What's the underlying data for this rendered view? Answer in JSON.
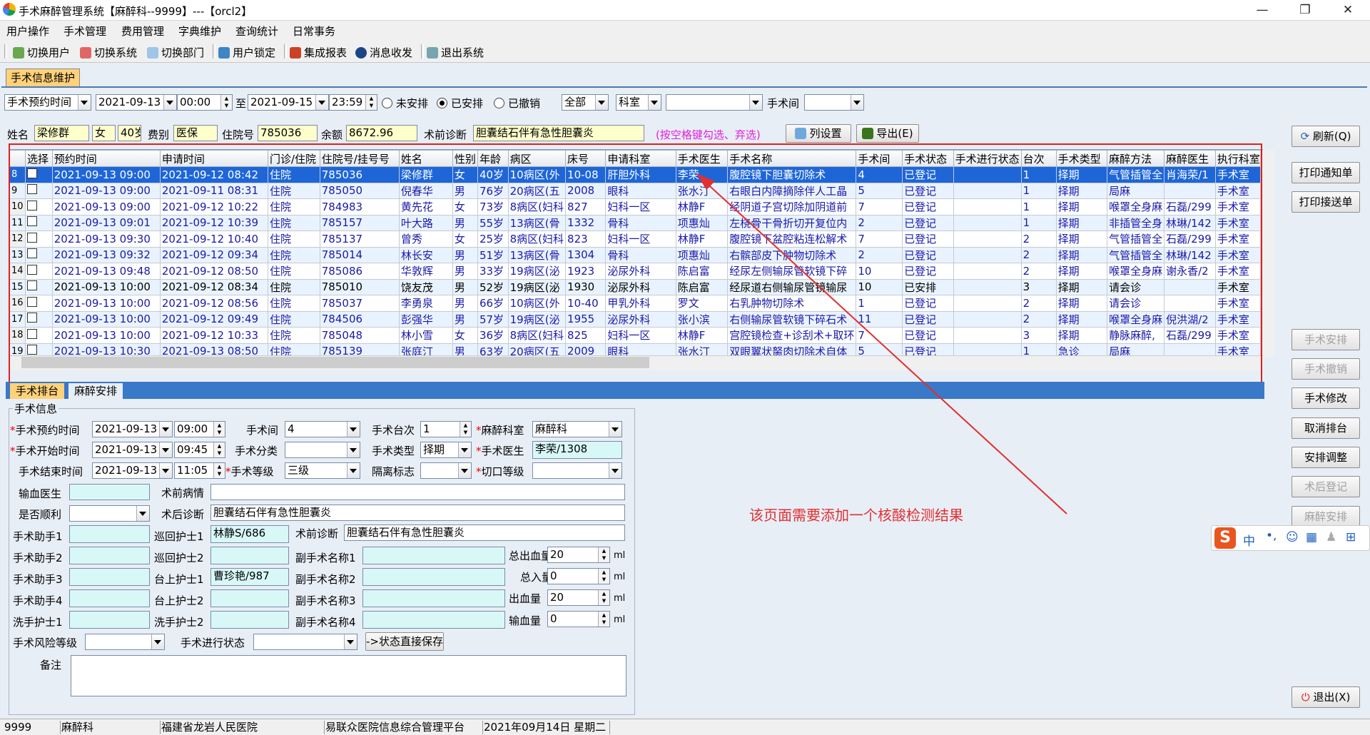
{
  "window": {
    "title": "手术麻醉管理系统【麻醉科--9999】---【orcl2】",
    "minimize": "—",
    "maximize": "❐",
    "close": "✕"
  },
  "menu": [
    "用户操作",
    "手术管理",
    "费用管理",
    "字典维护",
    "查询统计",
    "日常事务"
  ],
  "toolbar": [
    "切换用户",
    "切换系统",
    "切换部门",
    "用户锁定",
    "集成报表",
    "消息收发",
    "退出系统"
  ],
  "top_tab": "手术信息维护",
  "filter": {
    "time_type": "手术预约时间",
    "date_from": "2021-09-13",
    "time_from": "00:00",
    "to": "至",
    "date_to": "2021-09-15",
    "time_to": "23:59",
    "radio_unarranged": "未安排",
    "radio_arranged": "已安排",
    "radio_cancelled": "已撤销",
    "scope": "全部",
    "dept": "科室",
    "dept_value": "",
    "room_label": "手术间",
    "room_value": ""
  },
  "patient_bar": {
    "name_label": "姓名",
    "name": "梁修群",
    "sex": "女",
    "age": "40岁",
    "fee_label": "费别",
    "fee": "医保",
    "inpatient_label": "住院号",
    "inpatient_no": "785036",
    "balance_label": "余额",
    "balance": "8672.96",
    "diag_label": "术前诊断",
    "diagnosis": "胆囊结石伴有急性胆囊炎",
    "hint": "(按空格键勾选、弃选)",
    "col_setting": "列设置",
    "export": "导出(E)"
  },
  "grid": {
    "headers": [
      "",
      "选择",
      "预约时间",
      "申请时间",
      "门诊/住院",
      "住院号/挂号号",
      "姓名",
      "性别",
      "年龄",
      "病区",
      "床号",
      "申请科室",
      "手术医生",
      "手术名称",
      "手术间",
      "手术状态",
      "手术进行状态",
      "台次",
      "手术类型",
      "麻醉方法",
      "麻醉医生",
      "执行科室"
    ],
    "rows": [
      [
        "8",
        "",
        "2021-09-13 09:00",
        "2021-09-12 08:42",
        "住院",
        "785036",
        "梁修群",
        "女",
        "40岁",
        "10病区(外",
        "10-08",
        "肝胆外科",
        "李荣",
        "腹腔镜下胆囊切除术",
        "4",
        "已登记",
        "",
        "1",
        "择期",
        "气管插管全",
        "肖海荣/1",
        "手术室"
      ],
      [
        "9",
        "",
        "2021-09-13 09:00",
        "2021-09-11 08:31",
        "住院",
        "785050",
        "倪春华",
        "男",
        "76岁",
        "20病区(五",
        "2008",
        "眼科",
        "张水汀",
        "右眼白内障摘除伴人工晶",
        "5",
        "已登记",
        "",
        "1",
        "择期",
        "局麻",
        "",
        "手术室"
      ],
      [
        "10",
        "",
        "2021-09-13 09:00",
        "2021-09-12 10:22",
        "住院",
        "784983",
        "黄先花",
        "女",
        "73岁",
        "8病区(妇科",
        "827",
        "妇科一区",
        "林静F",
        "经阴道子宫切除加阴道前",
        "7",
        "已登记",
        "",
        "1",
        "择期",
        "喉罩全身麻",
        "石磊/299",
        "手术室"
      ],
      [
        "11",
        "",
        "2021-09-13 09:01",
        "2021-09-12 10:39",
        "住院",
        "785157",
        "叶大路",
        "男",
        "55岁",
        "13病区(骨",
        "1332",
        "骨科",
        "项惠灿",
        "左桡骨干骨折切开复位内",
        "2",
        "已登记",
        "",
        "1",
        "择期",
        "非插管全身",
        "林琳/142",
        "手术室"
      ],
      [
        "12",
        "",
        "2021-09-13 09:30",
        "2021-09-12 10:40",
        "住院",
        "785137",
        "曾秀",
        "女",
        "25岁",
        "8病区(妇科",
        "823",
        "妇科一区",
        "林静F",
        "腹腔镜下盆腔粘连松解术",
        "7",
        "已登记",
        "",
        "2",
        "择期",
        "气管插管全",
        "石磊/299",
        "手术室"
      ],
      [
        "13",
        "",
        "2021-09-13 09:32",
        "2021-09-12 09:34",
        "住院",
        "785014",
        "林长安",
        "男",
        "51岁",
        "13病区(骨",
        "1304",
        "骨科",
        "项惠灿",
        "右髌部皮下肿物切除术",
        "2",
        "已登记",
        "",
        "2",
        "择期",
        "气管插管全",
        "林琳/142",
        "手术室"
      ],
      [
        "14",
        "",
        "2021-09-13 09:48",
        "2021-09-12 08:50",
        "住院",
        "785086",
        "华敦辉",
        "男",
        "33岁",
        "19病区(泌",
        "1923",
        "泌尿外科",
        "陈启富",
        "经尿左侧输尿管软镜下碎",
        "10",
        "已登记",
        "",
        "2",
        "择期",
        "喉罩全身麻",
        "谢永香/2",
        "手术室"
      ],
      [
        "15",
        "",
        "2021-09-13 10:00",
        "2021-09-12 08:34",
        "住院",
        "785010",
        "饶友茂",
        "男",
        "52岁",
        "19病区(泌",
        "1930",
        "泌尿外科",
        "陈启富",
        "经尿道右侧输尿管镜输尿",
        "10",
        "已安排",
        "",
        "3",
        "择期",
        "请会诊",
        "",
        "手术室"
      ],
      [
        "16",
        "",
        "2021-09-13 10:00",
        "2021-09-12 08:56",
        "住院",
        "785037",
        "李勇泉",
        "男",
        "66岁",
        "10病区(外",
        "10-40",
        "甲乳外科",
        "罗文",
        "右乳肿物切除术",
        "1",
        "已登记",
        "",
        "2",
        "择期",
        "请会诊",
        "",
        "手术室"
      ],
      [
        "17",
        "",
        "2021-09-13 10:00",
        "2021-09-12 09:49",
        "住院",
        "784506",
        "彭强华",
        "男",
        "57岁",
        "19病区(泌",
        "1955",
        "泌尿外科",
        "张小滨",
        "右侧输尿管软镜下碎石术",
        "11",
        "已登记",
        "",
        "2",
        "择期",
        "喉罩全身麻",
        "倪洪湖/2",
        "手术室"
      ],
      [
        "18",
        "",
        "2021-09-13 10:00",
        "2021-09-12 10:33",
        "住院",
        "785048",
        "林小雪",
        "女",
        "36岁",
        "8病区(妇科",
        "825",
        "妇科一区",
        "林静F",
        "宫腔镜检查+诊刮术+取环",
        "7",
        "已登记",
        "",
        "3",
        "择期",
        "静脉麻醉,",
        "石磊/299",
        "手术室"
      ],
      [
        "19",
        "",
        "2021-09-13 10:30",
        "2021-09-13 08:50",
        "住院",
        "785139",
        "张庭汀",
        "男",
        "63岁",
        "20病区(五",
        "2009",
        "眼科",
        "张水汀",
        "双眼翼状胬肉切除术自体",
        "5",
        "已登记",
        "",
        "1",
        "急诊",
        "局麻",
        "",
        "手术室"
      ]
    ]
  },
  "lower_tabs": [
    "手术排台",
    "麻醉安排"
  ],
  "form": {
    "group_title": "手术信息",
    "appt_label": "手术预约时间",
    "appt_date": "2021-09-13",
    "appt_time": "09:00",
    "start_label": "手术开始时间",
    "start_date": "2021-09-13",
    "start_time": "09:45",
    "end_label": "手术结束时间",
    "end_date": "2021-09-13",
    "end_time": "11:05",
    "room_label": "手术间",
    "room": "4",
    "class_label": "手术分类",
    "class": "",
    "level_label": "手术等级",
    "level": "三级",
    "seq_label": "手术台次",
    "seq": "1",
    "type_label": "手术类型",
    "type": "择期",
    "iso_label": "隔离标志",
    "iso": "",
    "anes_dept_label": "麻醉科室",
    "anes_dept": "麻醉科",
    "surgeon_label": "手术医生",
    "surgeon": "李荣/1308",
    "incision_label": "切口等级",
    "incision": "",
    "transfusion_doc_label": "输血医生",
    "transfusion_doc": "",
    "smooth_label": "是否顺利",
    "smooth": "",
    "pre_cond_label": "术前病情",
    "pre_cond": "",
    "post_diag_label": "术后诊断",
    "post_diag": "胆囊结石伴有急性胆囊炎",
    "pre_diag_label": "术前诊断",
    "pre_diag": "胆囊结石伴有急性胆囊炎",
    "assist1_label": "手术助手1",
    "assist2_label": "手术助手2",
    "assist3_label": "手术助手3",
    "assist4_label": "手术助手4",
    "wash1_label": "洗手护士1",
    "circ1_label": "巡回护士1",
    "circ1": "林静S/686",
    "circ2_label": "巡回护士2",
    "circ2": "",
    "table1_label": "台上护士1",
    "table1": "曹珍艳/987",
    "table2_label": "台上护士2",
    "wash2_label": "洗手护士2",
    "sub1_label": "副手术名称1",
    "sub2_label": "副手术名称2",
    "sub3_label": "副手术名称3",
    "sub4_label": "副手术名称4",
    "bleed_label": "总出血量",
    "bleed": "20",
    "intake_label": "总入量",
    "intake": "0",
    "output_label": "出血量",
    "output": "20",
    "blood_label": "输血量",
    "blood": "0",
    "unit": "ml",
    "risk_label": "手术风险等级",
    "progress_label": "手术进行状态",
    "save_btn": "->状态直接保存",
    "remark_label": "备注"
  },
  "right_buttons": {
    "refresh": "刷新(Q)",
    "print_notice": "打印通知单",
    "print_transfer": "打印接送单",
    "arrange": "手术安排",
    "cancel": "手术撤销",
    "modify": "手术修改",
    "cancel_sched": "取消排台",
    "adjust": "安排调整",
    "post_reg": "术后登记",
    "anes_arrange": "麻醉安排",
    "exit": "退出(X)"
  },
  "annotation": "该页面需要添加一个核酸检测结果",
  "statusbar": [
    "9999",
    "麻醉科",
    "福建省龙岩人民医院",
    "易联众医院信息综合管理平台",
    "2021年09月14日 星期二"
  ],
  "ime": {
    "s": "S",
    "zh": "中"
  }
}
